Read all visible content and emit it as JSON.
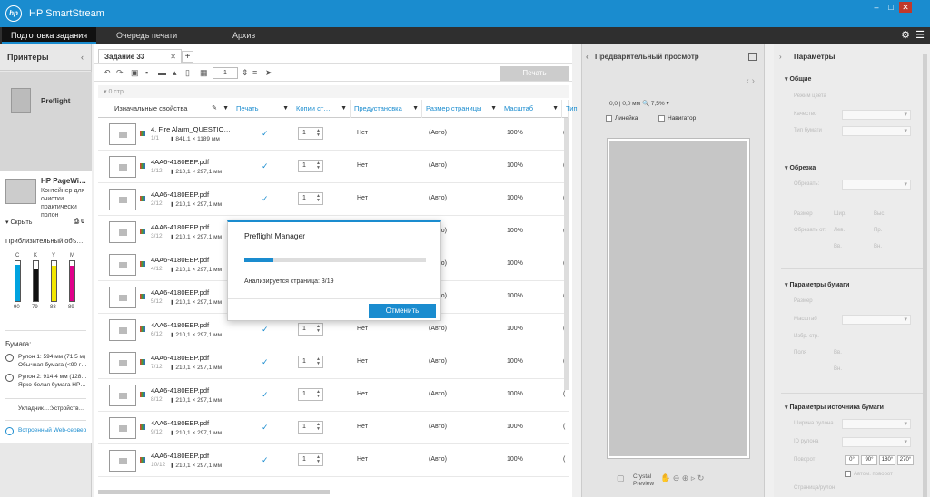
{
  "app": {
    "logo": "hp",
    "title": "HP SmartStream",
    "window_buttons": [
      "–",
      "□",
      "✕"
    ]
  },
  "menu": {
    "tabs": [
      "Подготовка задания",
      "Очередь печати",
      "Архив"
    ],
    "active": 0,
    "settings_icon": "gear-icon",
    "menu_icon": "hamburger-icon"
  },
  "left": {
    "title": "Принтеры",
    "preflight_label": "Preflight",
    "printer": {
      "name": "HP PageWi…",
      "desc": "Контейнер для очистки практически полон",
      "hide": "Скрыть",
      "queue_count": "0"
    },
    "ink_title": "Приблизительный объ…",
    "inks": [
      {
        "label": "C",
        "level": 90,
        "value": "90",
        "color": "#00a3e0"
      },
      {
        "label": "K",
        "level": 79,
        "value": "79",
        "color": "#111111"
      },
      {
        "label": "Y",
        "level": 88,
        "value": "88",
        "color": "#f2e600"
      },
      {
        "label": "M",
        "level": 89,
        "value": "89",
        "color": "#e0008a"
      }
    ],
    "paper_title": "Бумага:",
    "rolls": [
      {
        "line1": "Рулон 1: 594 мм (71,5 м)",
        "line2": "Обычная бумага (<90 г…"
      },
      {
        "line1": "Рулон 2: 914,4 мм (128…",
        "line2": "Ярко-белая бумага HP…"
      }
    ],
    "tray": "Укладчик…:Устройств…",
    "ews": "Встроенный Web-сервер"
  },
  "job": {
    "tab": "Задание 33",
    "add": "+",
    "page_input": "1",
    "print_button": "Печать",
    "page_count": "0 стр",
    "columns": [
      "Изначальные свойства",
      "Печать",
      "Копии ст…",
      "Предустановка",
      "Размер страницы",
      "Масштаб",
      "Тип"
    ],
    "rows": [
      {
        "name": "4. Fire Alarm_QUESTIO…",
        "pages": "1/1",
        "dims": "841,1 × 1189 мм",
        "copies": "1",
        "preset": "Нет",
        "size": "(Авто)",
        "scale": "100%",
        "trunc": "("
      },
      {
        "name": "4AA6-4180EEP.pdf",
        "pages": "1/12",
        "dims": "210,1 × 297,1 мм",
        "copies": "1",
        "preset": "Нет",
        "size": "(Авто)",
        "scale": "100%",
        "trunc": "("
      },
      {
        "name": "4AA6-4180EEP.pdf",
        "pages": "2/12",
        "dims": "210,1 × 297,1 мм",
        "copies": "1",
        "preset": "Нет",
        "size": "(Авто)",
        "scale": "100%",
        "trunc": "("
      },
      {
        "name": "4AA6-4180EEP.pdf",
        "pages": "3/12",
        "dims": "210,1 × 297,1 мм",
        "copies": "1",
        "preset": "Нет",
        "size": "(Авто)",
        "scale": "100%",
        "trunc": "("
      },
      {
        "name": "4AA6-4180EEP.pdf",
        "pages": "4/12",
        "dims": "210,1 × 297,1 мм",
        "copies": "1",
        "preset": "Нет",
        "size": "(Авто)",
        "scale": "100%",
        "trunc": "("
      },
      {
        "name": "4AA6-4180EEP.pdf",
        "pages": "5/12",
        "dims": "210,1 × 297,1 мм",
        "copies": "1",
        "preset": "Нет",
        "size": "(Авто)",
        "scale": "100%",
        "trunc": "("
      },
      {
        "name": "4AA6-4180EEP.pdf",
        "pages": "6/12",
        "dims": "210,1 × 297,1 мм",
        "copies": "1",
        "preset": "Нет",
        "size": "(Авто)",
        "scale": "100%",
        "trunc": "("
      },
      {
        "name": "4AA6-4180EEP.pdf",
        "pages": "7/12",
        "dims": "210,1 × 297,1 мм",
        "copies": "1",
        "preset": "Нет",
        "size": "(Авто)",
        "scale": "100%",
        "trunc": "("
      },
      {
        "name": "4AA6-4180EEP.pdf",
        "pages": "8/12",
        "dims": "210,1 × 297,1 мм",
        "copies": "1",
        "preset": "Нет",
        "size": "(Авто)",
        "scale": "100%",
        "trunc": "("
      },
      {
        "name": "4AA6-4180EEP.pdf",
        "pages": "9/12",
        "dims": "210,1 × 297,1 мм",
        "copies": "1",
        "preset": "Нет",
        "size": "(Авто)",
        "scale": "100%",
        "trunc": "("
      },
      {
        "name": "4AA6-4180EEP.pdf",
        "pages": "10/12",
        "dims": "210,1 × 297,1 мм",
        "copies": "1",
        "preset": "Нет",
        "size": "(Авто)",
        "scale": "100%",
        "trunc": "("
      }
    ]
  },
  "dialog": {
    "title": "Preflight Manager",
    "status": "Анализируется страница: 3/19",
    "progress": 0.16,
    "cancel": "Отменить"
  },
  "preview": {
    "title": "Предварительный просмотр",
    "coords": "0,0 | 0,0 мм",
    "zoom": "7,5%",
    "ruler": "Линейка",
    "navigator": "Навигатор",
    "crystal": "Crystal Preview"
  },
  "params": {
    "title": "Параметры",
    "sections": [
      "Общие",
      "Обрезка",
      "Параметры бумаги",
      "Параметры источника бумаги"
    ],
    "general": [
      "Режим цвета",
      "Качество",
      "Тип бумаги"
    ],
    "crop": [
      "Обрезать:",
      "Размер",
      "Обрезать от:",
      "Шир.",
      "Выс.",
      "Лев.",
      "Пр.",
      "Вв.",
      "Вн."
    ],
    "paper": [
      "Размер",
      "Масштаб",
      "Избр. стр.",
      "Поля",
      "Вв.",
      "Вн."
    ],
    "source": [
      "Ширина рулона",
      "ID рулона",
      "Поворот",
      "Автом. поворот",
      "Страница/рулон"
    ],
    "rotations": [
      "0°",
      "90°",
      "180°",
      "270°"
    ]
  }
}
